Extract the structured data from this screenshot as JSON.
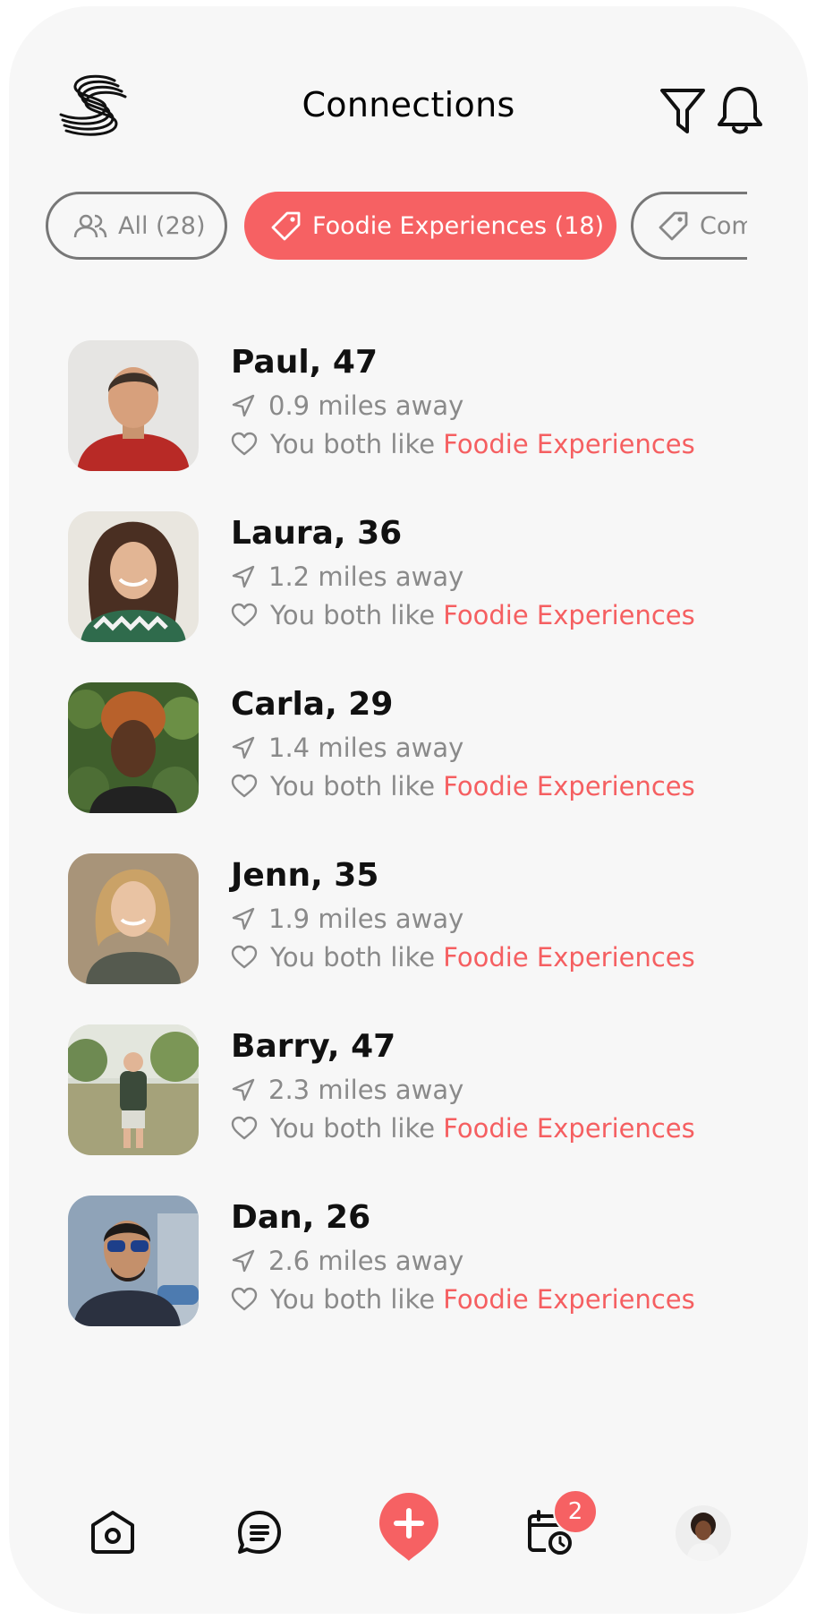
{
  "header": {
    "title": "Connections",
    "icons": [
      "logo-s-icon",
      "filter-icon",
      "bell-icon"
    ]
  },
  "filters": [
    {
      "label": "All (28)",
      "icon": "people-icon",
      "active": false
    },
    {
      "label": "Foodie Experiences (18)",
      "icon": "tag-icon",
      "active": true
    },
    {
      "label": "Com",
      "icon": "tag-icon",
      "active": false
    }
  ],
  "connections": [
    {
      "name": "Paul, 47",
      "distance": "0.9 miles away",
      "likes_prefix": "You both like ",
      "likes_interest": "Foodie Experiences"
    },
    {
      "name": "Laura, 36",
      "distance": "1.2 miles away",
      "likes_prefix": "You both like ",
      "likes_interest": "Foodie Experiences"
    },
    {
      "name": "Carla, 29",
      "distance": "1.4 miles away",
      "likes_prefix": "You both like ",
      "likes_interest": "Foodie Experiences"
    },
    {
      "name": "Jenn, 35",
      "distance": "1.9 miles away",
      "likes_prefix": "You both like ",
      "likes_interest": "Foodie Experiences"
    },
    {
      "name": "Barry, 47",
      "distance": "2.3 miles away",
      "likes_prefix": "You both like ",
      "likes_interest": "Foodie Experiences"
    },
    {
      "name": "Dan, 26",
      "distance": "2.6 miles away",
      "likes_prefix": "You both like ",
      "likes_interest": "Foodie Experiences"
    }
  ],
  "tabbar": {
    "tabs": [
      "home-icon",
      "chat-icon",
      "add-icon",
      "calendar-icon",
      "profile-avatar"
    ],
    "calendar_badge": "2"
  },
  "colors": {
    "accent": "#f66163",
    "background": "#f7f7f7",
    "muted_text": "#8a8a8a"
  }
}
